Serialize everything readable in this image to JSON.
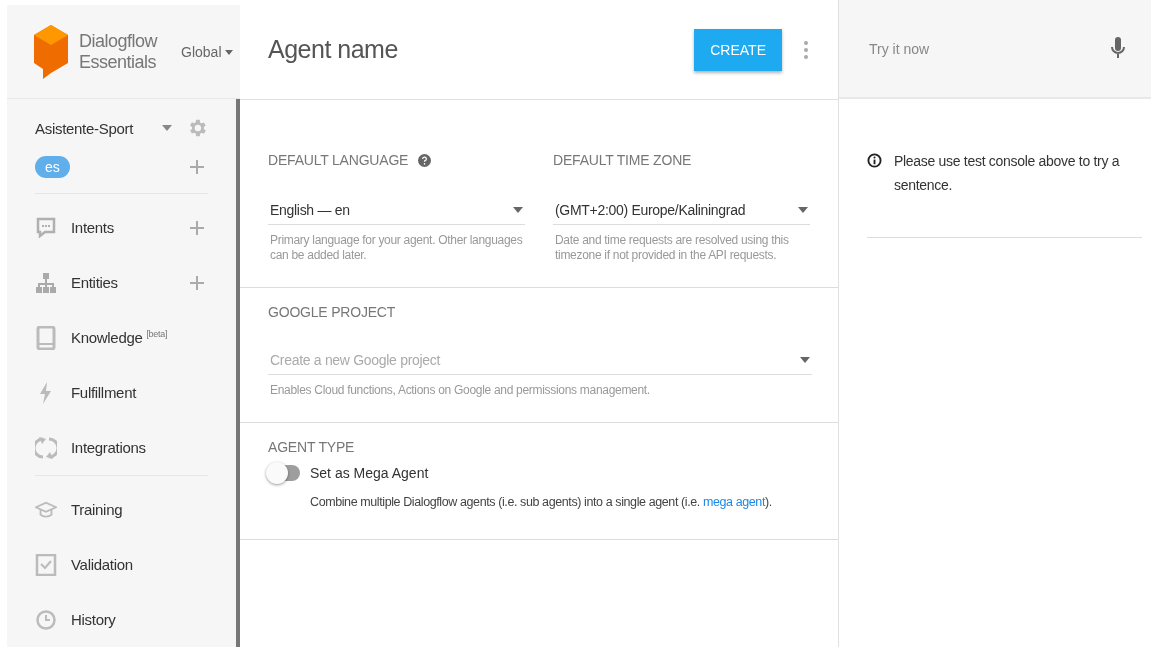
{
  "brand": {
    "line1": "Dialogflow",
    "line2": "Essentials",
    "region": "Global"
  },
  "agent": {
    "name": "Asistente-Sport",
    "languages": [
      {
        "code": "es",
        "selected": true
      }
    ]
  },
  "sidebar": {
    "groups": [
      {
        "items": [
          {
            "label": "Intents",
            "has_add": true
          },
          {
            "label": "Entities",
            "has_add": true
          },
          {
            "label": "Knowledge $^{[beta]}$",
            "has_add": false
          },
          {
            "label": "Fulfillment",
            "has_add": false
          },
          {
            "label": "Integrations",
            "has_add": false
          }
        ]
      },
      {
        "items": [
          {
            "label": "Training",
            "has_add": false
          },
          {
            "label": "Validation",
            "has_add": false
          },
          {
            "label": "History",
            "has_add": false
          }
        ]
      }
    ]
  },
  "header": {
    "title": "Agent name",
    "create_button": "CREATE"
  },
  "settings": {
    "language": {
      "label": "DEFAULT LANGUAGE",
      "value": "English — en",
      "help": "Primary language for your agent. Other languages can be added later."
    },
    "timezone": {
      "label": "DEFAULT TIME ZONE",
      "value": "(GMT+2:00) Europe/Kaliningrad",
      "help": "Date and time requests are resolved using this timezone if not provided in the API requests."
    },
    "google_project": {
      "label": "GOOGLE PROJECT",
      "placeholder": "Create a new Google project",
      "help": "Enables Cloud functions, Actions on Google and permissions management."
    },
    "agent_type": {
      "label": "AGENT TYPE",
      "toggle_label": "Set as Mega Agent",
      "on": false,
      "description": "Combine multiple Dialogflow agents (i.e. sub agents) into a single agent (i.e. ",
      "link": "mega agent",
      "after_link": ")."
    }
  },
  "console": {
    "placeholder": "Try it now",
    "message": "Please use test console above to try a sentence."
  }
}
